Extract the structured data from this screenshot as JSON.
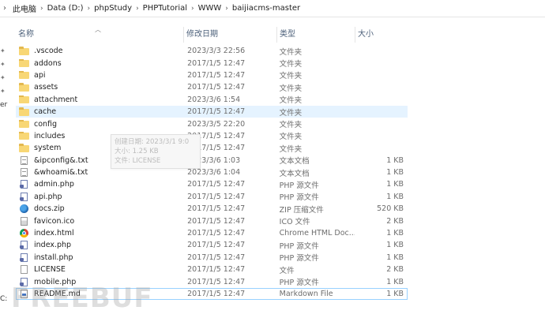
{
  "address_bar": {
    "crumbs": [
      "此电脑",
      "Data (D:)",
      "phpStudy",
      "PHPTutorial",
      "WWW",
      "baijiacms-master"
    ]
  },
  "nav_pane": {
    "partial_labels": [
      "er",
      "C:"
    ]
  },
  "columns": {
    "name": "名称",
    "date": "修改日期",
    "type": "类型",
    "size": "大小"
  },
  "files": [
    {
      "name": ".vscode",
      "date": "2023/3/3 22:56",
      "type": "文件夹",
      "size": "",
      "icon": "folder-icon"
    },
    {
      "name": "addons",
      "date": "2017/1/5 12:47",
      "type": "文件夹",
      "size": "",
      "icon": "folder-icon"
    },
    {
      "name": "api",
      "date": "2017/1/5 12:47",
      "type": "文件夹",
      "size": "",
      "icon": "folder-icon"
    },
    {
      "name": "assets",
      "date": "2017/1/5 12:47",
      "type": "文件夹",
      "size": "",
      "icon": "folder-icon"
    },
    {
      "name": "attachment",
      "date": "2023/3/6 1:54",
      "type": "文件夹",
      "size": "",
      "icon": "folder-icon"
    },
    {
      "name": "cache",
      "date": "2017/1/5 12:47",
      "type": "文件夹",
      "size": "",
      "icon": "folder-icon"
    },
    {
      "name": "config",
      "date": "2023/3/5 22:20",
      "type": "文件夹",
      "size": "",
      "icon": "folder-icon"
    },
    {
      "name": "includes",
      "date": "2017/1/5 12:47",
      "type": "文件夹",
      "size": "",
      "icon": "folder-icon"
    },
    {
      "name": "system",
      "date": "2017/1/5 12:47",
      "type": "文件夹",
      "size": "",
      "icon": "folder-icon"
    },
    {
      "name": "&ipconfig&.txt",
      "date": "2023/3/6 1:03",
      "type": "文本文档",
      "size": "1 KB",
      "icon": "text-file-icon"
    },
    {
      "name": "&whoami&.txt",
      "date": "2023/3/6 1:04",
      "type": "文本文档",
      "size": "1 KB",
      "icon": "text-file-icon"
    },
    {
      "name": "admin.php",
      "date": "2017/1/5 12:47",
      "type": "PHP 源文件",
      "size": "1 KB",
      "icon": "php-file-icon"
    },
    {
      "name": "api.php",
      "date": "2017/1/5 12:47",
      "type": "PHP 源文件",
      "size": "1 KB",
      "icon": "php-file-icon"
    },
    {
      "name": "docs.zip",
      "date": "2017/1/5 12:47",
      "type": "ZIP 压缩文件",
      "size": "520 KB",
      "icon": "zip-file-icon"
    },
    {
      "name": "favicon.ico",
      "date": "2017/1/5 12:47",
      "type": "ICO 文件",
      "size": "2 KB",
      "icon": "ico-file-icon"
    },
    {
      "name": "index.html",
      "date": "2017/1/5 12:47",
      "type": "Chrome HTML Doc...",
      "size": "1 KB",
      "icon": "chrome-html-icon"
    },
    {
      "name": "index.php",
      "date": "2017/1/5 12:47",
      "type": "PHP 源文件",
      "size": "1 KB",
      "icon": "php-file-icon"
    },
    {
      "name": "install.php",
      "date": "2017/1/5 12:47",
      "type": "PHP 源文件",
      "size": "1 KB",
      "icon": "php-file-icon"
    },
    {
      "name": "LICENSE",
      "date": "2017/1/5 12:47",
      "type": "文件",
      "size": "2 KB",
      "icon": "plain-file-icon"
    },
    {
      "name": "mobile.php",
      "date": "2017/1/5 12:47",
      "type": "PHP 源文件",
      "size": "1 KB",
      "icon": "php-file-icon"
    },
    {
      "name": "README.md",
      "date": "2017/1/5 12:47",
      "type": "Markdown File",
      "size": "1 KB",
      "icon": "markdown-file-icon"
    }
  ],
  "hover_row_index": 5,
  "focused_row_index": 20,
  "tooltip": {
    "created": "创建日期: 2023/3/1 9:0",
    "size": "大小: 1.25 KB",
    "file": "文件: LICENSE"
  },
  "watermark": "FREEBUF"
}
